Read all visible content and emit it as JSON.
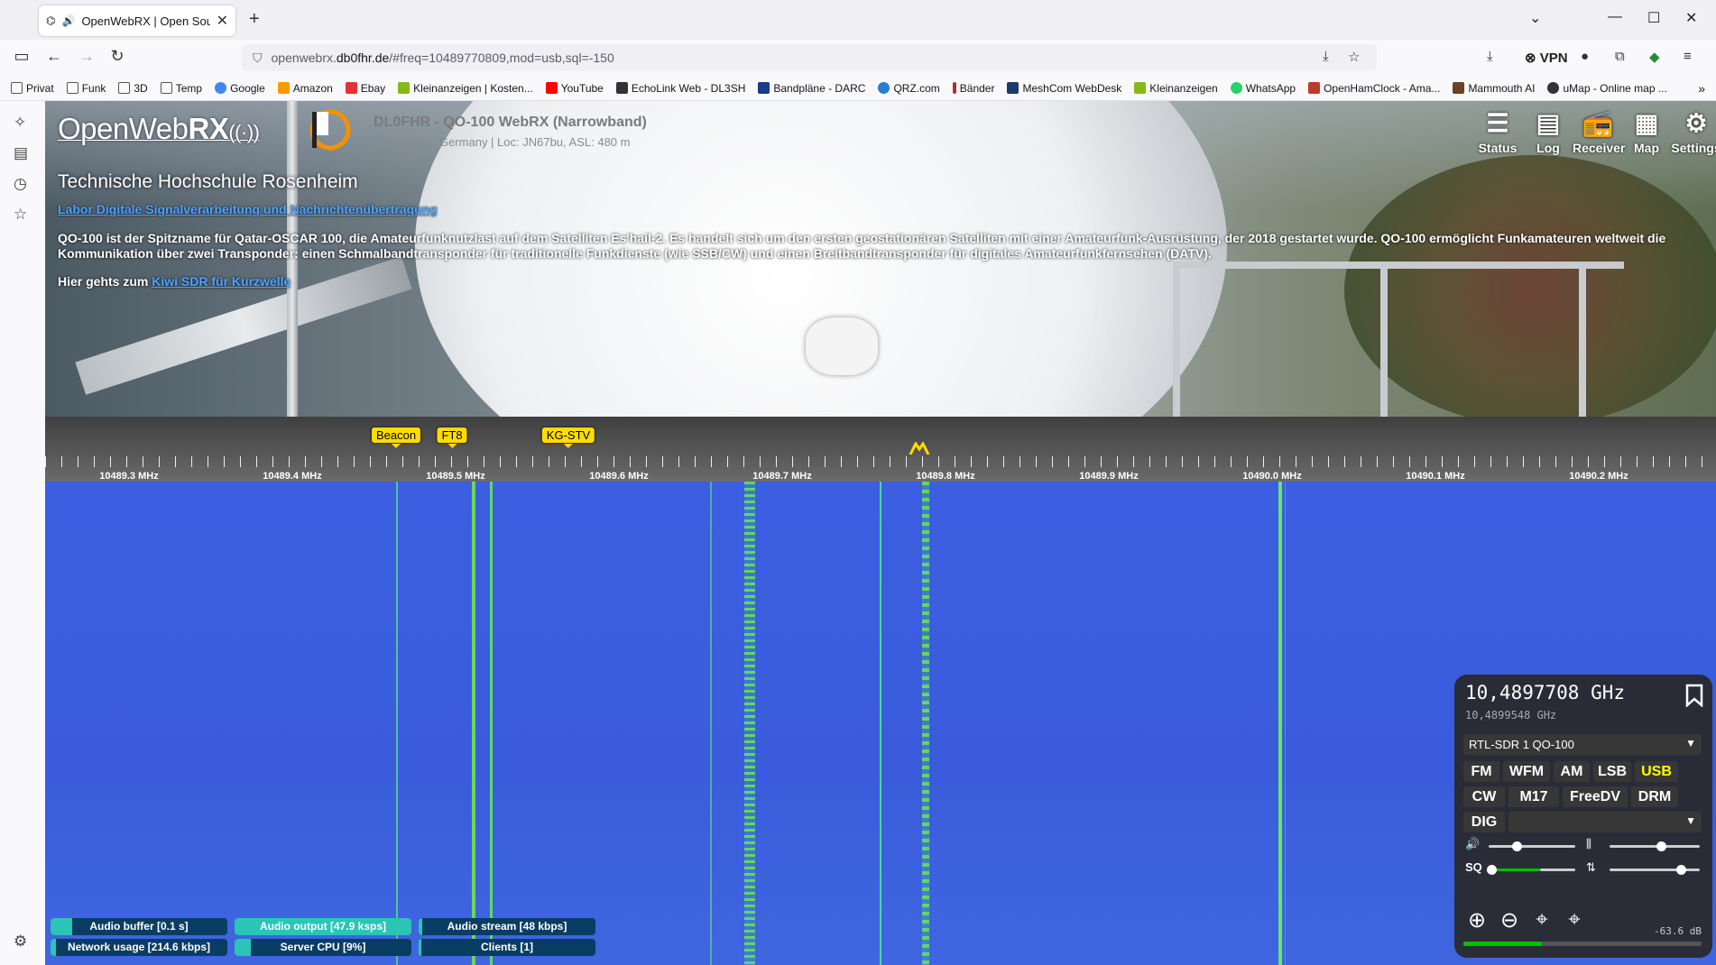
{
  "browser": {
    "tab_title": "OpenWebRX | Open Source",
    "url_prefix": "openwebrx.",
    "url_domain": "db0fhr.de",
    "url_path": "/#freq=10489770809,mod=usb,sql=-150",
    "vpn_label": "VPN"
  },
  "bookmarks": [
    {
      "label": "Privat",
      "icon": "folder-icon",
      "color": "#555555"
    },
    {
      "label": "Funk",
      "icon": "folder-icon",
      "color": "#555555"
    },
    {
      "label": "3D",
      "icon": "folder-icon",
      "color": "#555555"
    },
    {
      "label": "Temp",
      "icon": "folder-icon",
      "color": "#555555"
    },
    {
      "label": "Google",
      "icon": "google-icon",
      "color": "#4285f4"
    },
    {
      "label": "Amazon",
      "icon": "amazon-icon",
      "color": "#ff9900"
    },
    {
      "label": "Ebay",
      "icon": "ebay-icon",
      "color": "#e53238"
    },
    {
      "label": "Kleinanzeigen | Kosten...",
      "icon": "kleinanzeigen-icon",
      "color": "#86b817"
    },
    {
      "label": "YouTube",
      "icon": "youtube-icon",
      "color": "#ff0000"
    },
    {
      "label": "EchoLink Web - DL3SH",
      "icon": "echolink-icon",
      "color": "#333333"
    },
    {
      "label": "Bandpläne - DARC",
      "icon": "darc-icon",
      "color": "#1a3a8a"
    },
    {
      "label": "QRZ.com",
      "icon": "qrz-icon",
      "color": "#2a7bd4"
    },
    {
      "label": "Bänder",
      "icon": "pin-icon",
      "color": "#b03030"
    },
    {
      "label": "MeshCom WebDesk",
      "icon": "meshcom-icon",
      "color": "#1a3a6a"
    },
    {
      "label": "Kleinanzeigen",
      "icon": "kleinanzeigen-icon",
      "color": "#86b817"
    },
    {
      "label": "WhatsApp",
      "icon": "whatsapp-icon",
      "color": "#25d366"
    },
    {
      "label": "OpenHamClock - Ama...",
      "icon": "openhamclock-icon",
      "color": "#c0392b"
    },
    {
      "label": "Mammouth AI",
      "icon": "mammouth-icon",
      "color": "#6b4226"
    },
    {
      "label": "uMap - Online map ...",
      "icon": "umap-icon",
      "color": "#333333"
    }
  ],
  "header": {
    "logo_open": "Open",
    "logo_web": "Web",
    "logo_rx": "RX",
    "receiver_name": "DL0FHR - QO-100 WebRX (Narrowband)",
    "receiver_location": "Rosenheim, Germany | Loc: JN67bu, ASL: 480 m",
    "buttons": [
      {
        "label": "Status",
        "icon": "status-icon"
      },
      {
        "label": "Log",
        "icon": "log-icon"
      },
      {
        "label": "Receiver",
        "icon": "receiver-icon"
      },
      {
        "label": "Map",
        "icon": "map-icon"
      },
      {
        "label": "Settings",
        "icon": "settings-icon"
      }
    ]
  },
  "description": {
    "title": "Technische Hochschule Rosenheim",
    "link": "Labor Digitale Signalverarbeitung und Nachrichtenübertragung",
    "text": "QO-100 ist der Spitzname für Qatar-OSCAR 100, die Amateurfunknutzlast auf dem Satelliten Es'hail-2. Es handelt sich um den ersten geostationären Satelliten mit einer Amateurfunk-Ausrüstung, der 2018 gestartet wurde. QO-100 ermöglicht Funkamateuren weltweit die Kommunikation über zwei Transponder: einen Schmalbandtransponder für traditionelle Funkdienste (wie SSB/CW) und einen Breitbandtransponder für digitales Amateurfunkfernsehen (DATV).",
    "kiwi_prefix": "Hier gehts zum ",
    "kiwi_link": "Kiwi SDR für Kurzwelle"
  },
  "scale": {
    "ticks": [
      "10489.3 MHz",
      "10489.4 MHz",
      "10489.5 MHz",
      "10489.6 MHz",
      "10489.7 MHz",
      "10489.8 MHz",
      "10489.9 MHz",
      "10490.0 MHz",
      "10490.1 MHz",
      "10490.2 MHz"
    ],
    "bookmarks": [
      "Beacon",
      "FT8",
      "KG-STV"
    ]
  },
  "status": {
    "audio_buffer": "Audio buffer [0.1 s]",
    "audio_output": "Audio output [47.9 ksps]",
    "audio_stream": "Audio stream [48 kbps]",
    "network_usage": "Network usage [214.6 kbps]",
    "server_cpu": "Server CPU [9%]",
    "clients": "Clients [1]",
    "cpu_level": 0.09
  },
  "panel": {
    "frequency": "10,4897708 GHz",
    "secondary_frequency": "10,4899548 GHz",
    "profile": "RTL-SDR 1 QO-100",
    "modes_row1": [
      "FM",
      "WFM",
      "AM",
      "LSB",
      "USB"
    ],
    "modes_row2": [
      "CW",
      "M17",
      "FreeDV",
      "DRM"
    ],
    "dig_label": "DIG",
    "selected_mode": "USB",
    "db_value": "-63.6 dB",
    "volume_level": 0.32,
    "squelch_level": 0.0,
    "signal_level": 0.33
  },
  "colors": {
    "accent": "#ffdc00",
    "waterfall": "#3b5fe0",
    "signal": "#5ee06a",
    "status_bar": "#0a3d62",
    "status_fill": "#2ac5b5"
  }
}
